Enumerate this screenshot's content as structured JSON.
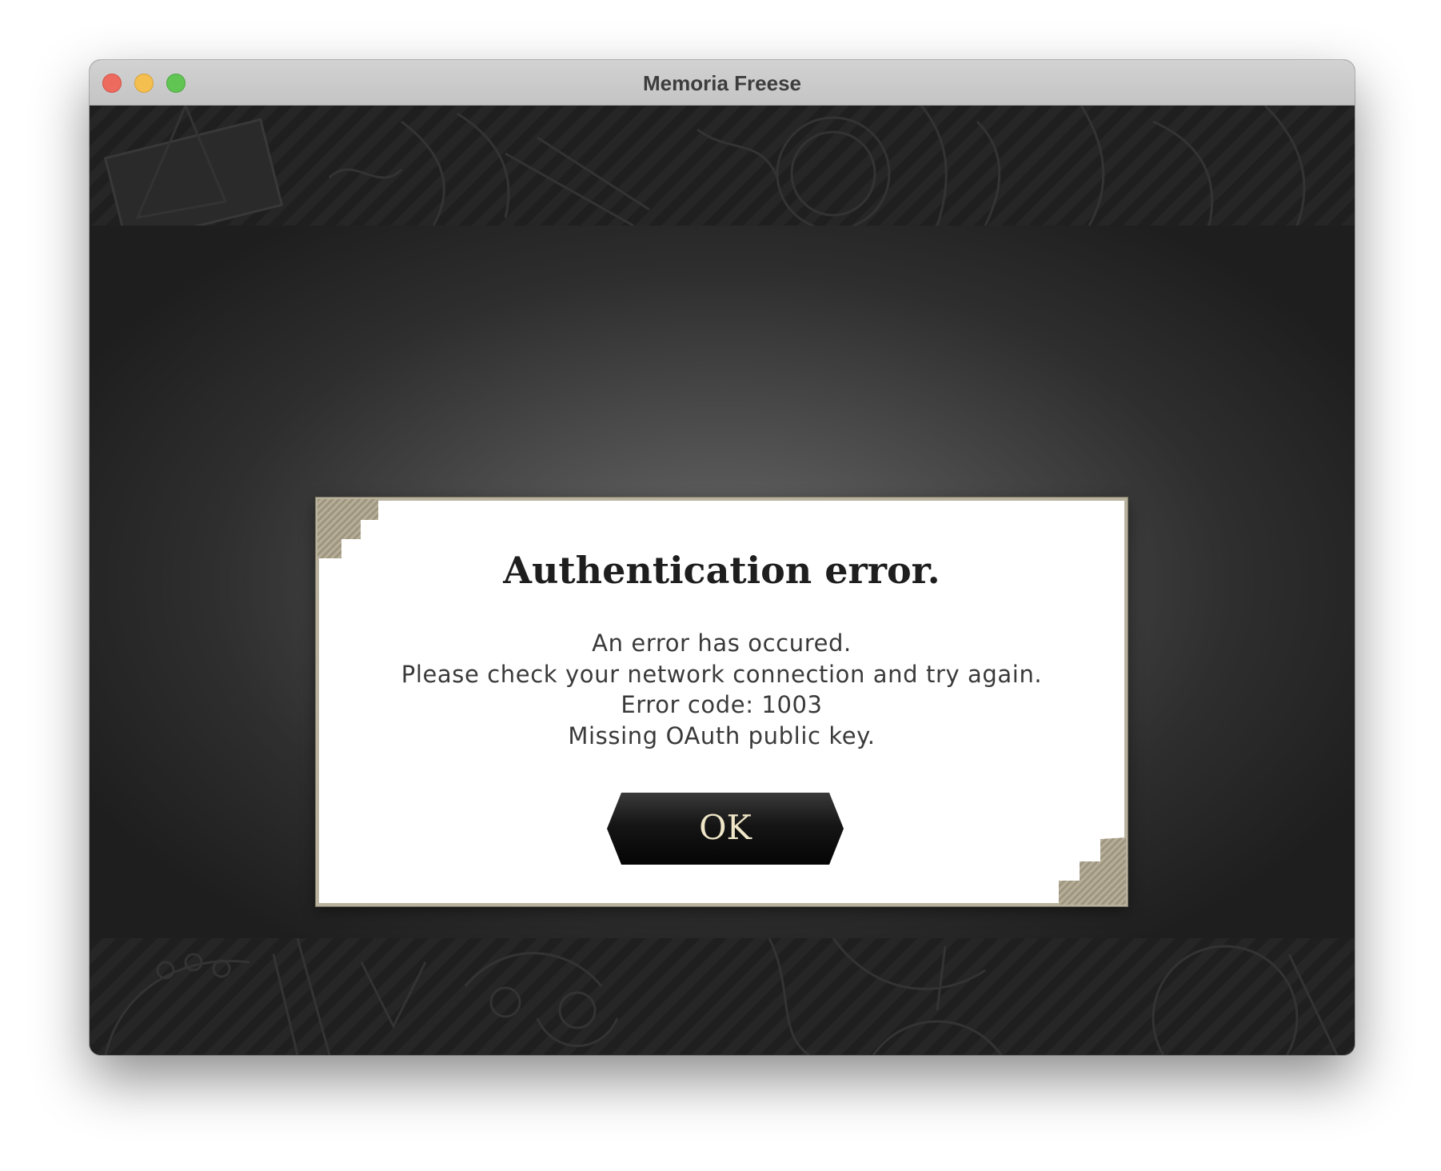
{
  "window": {
    "title": "Memoria Freese",
    "controls": [
      "close",
      "minimize",
      "zoom"
    ]
  },
  "dialog": {
    "title": "Authentication error.",
    "messages": [
      "An error has occured.",
      "Please check your network connection and try again.",
      "Error code: 1003",
      "Missing OAuth public key."
    ],
    "ok_label": "OK"
  },
  "colors": {
    "close": "#ed6a5e",
    "minimize": "#f5bf4f",
    "zoom": "#61c554",
    "dialog_border": "#b9b29e",
    "button_text": "#efe6c8"
  }
}
